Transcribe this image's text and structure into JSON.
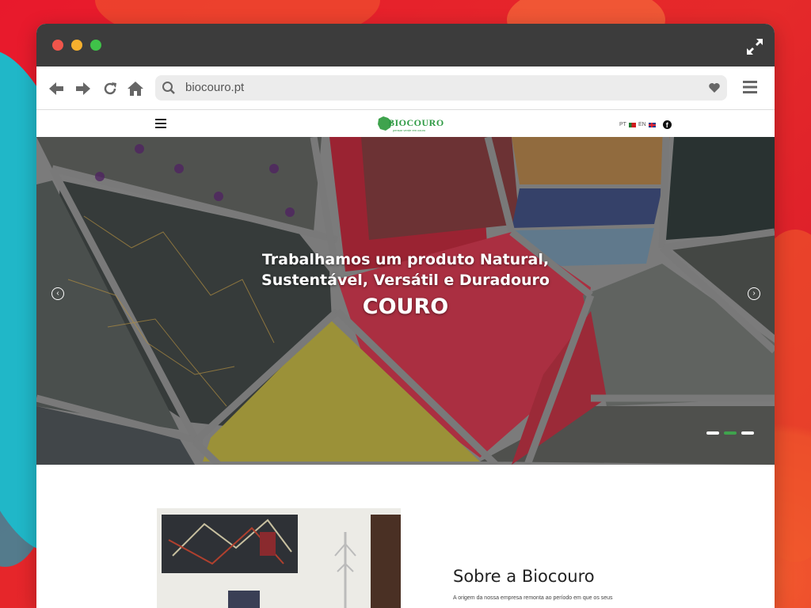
{
  "browser": {
    "url": "biocouro.pt"
  },
  "site": {
    "logo_text": "BIOCOURO",
    "logo_tagline": "pensar verde em couro",
    "languages": [
      "PT",
      "EN"
    ]
  },
  "hero": {
    "line1": "Trabalhamos um produto Natural,",
    "line2": "Sustentável, Versátil e Duradouro",
    "highlight": "COURO",
    "prev_icon": "chevron-left-icon",
    "next_icon": "chevron-right-icon",
    "slides_count": 3,
    "active_slide": 2
  },
  "about": {
    "title": "Sobre a Biocouro",
    "text": "A origem da nossa empresa remonta ao período em que os seus"
  },
  "colors": {
    "brand_green": "#2f9a44",
    "titlebar": "#3c3c3c"
  }
}
